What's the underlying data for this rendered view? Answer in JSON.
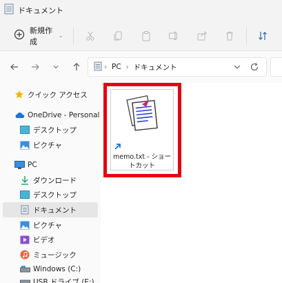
{
  "window": {
    "title": "ドキュメント"
  },
  "commandbar": {
    "new_label": "新規作成"
  },
  "address": {
    "crumbs": [
      "PC",
      "ドキュメント"
    ]
  },
  "sidebar": {
    "items": [
      {
        "label": "クイック アクセス",
        "icon": "star-icon"
      },
      {
        "label": "OneDrive - Personal",
        "icon": "cloud-icon"
      },
      {
        "label": "デスクトップ",
        "icon": "desktop-icon"
      },
      {
        "label": "ピクチャ",
        "icon": "pictures-icon"
      },
      {
        "label": "PC",
        "icon": "pc-icon"
      },
      {
        "label": "ダウンロード",
        "icon": "download-icon"
      },
      {
        "label": "デスクトップ",
        "icon": "desktop-icon"
      },
      {
        "label": "ドキュメント",
        "icon": "documents-icon",
        "selected": true
      },
      {
        "label": "ピクチャ",
        "icon": "pictures-icon"
      },
      {
        "label": "ビデオ",
        "icon": "video-icon"
      },
      {
        "label": "ミュージック",
        "icon": "music-icon"
      },
      {
        "label": "Windows (C:)",
        "icon": "drive-icon"
      },
      {
        "label": "USB ドライブ (E:)",
        "icon": "usb-drive-icon"
      }
    ]
  },
  "files": [
    {
      "name_line1": "memo.txt - ショー",
      "name_line2": "トカット",
      "type": "shortcut"
    }
  ],
  "colors": {
    "highlight": "#e50012",
    "accent": "#0067c0"
  }
}
